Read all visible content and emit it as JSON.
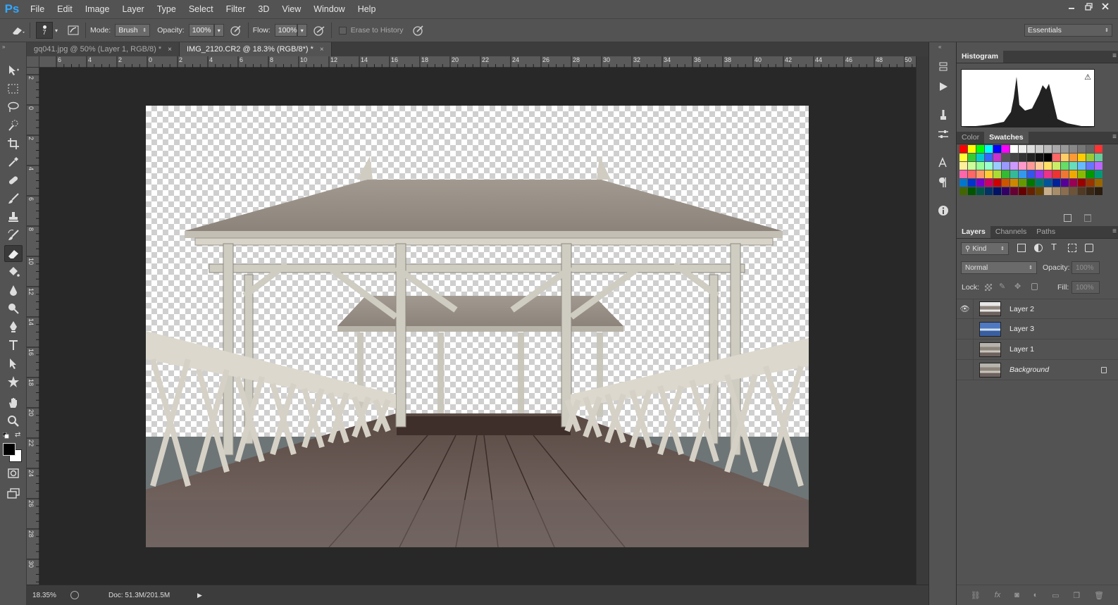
{
  "app": {
    "logo": "Ps"
  },
  "menus": [
    "File",
    "Edit",
    "Image",
    "Layer",
    "Type",
    "Select",
    "Filter",
    "3D",
    "View",
    "Window",
    "Help"
  ],
  "options": {
    "brush_size": "7",
    "mode_label": "Mode:",
    "mode_value": "Brush",
    "opacity_label": "Opacity:",
    "opacity_value": "100%",
    "flow_label": "Flow:",
    "flow_value": "100%",
    "erase_to_history": "Erase to History",
    "workspace": "Essentials"
  },
  "tabs": [
    {
      "label": "gq041.jpg @ 50% (Layer 1, RGB/8) *",
      "close": "×",
      "active": false
    },
    {
      "label": "IMG_2120.CR2 @ 18.3% (RGB/8*) *",
      "close": "×",
      "active": true
    }
  ],
  "rulers": {
    "h": [
      "6",
      "4",
      "2",
      "0",
      "2",
      "4",
      "6",
      "8",
      "10",
      "12",
      "14",
      "16",
      "18",
      "20",
      "22",
      "24",
      "26",
      "28",
      "30",
      "32",
      "34",
      "36",
      "38",
      "40",
      "42",
      "44",
      "46",
      "48",
      "50"
    ],
    "v": [
      "2",
      "0",
      "2",
      "4",
      "6",
      "8",
      "10",
      "12",
      "14",
      "16",
      "18",
      "20",
      "22",
      "24",
      "26",
      "28",
      "30"
    ]
  },
  "status": {
    "zoom": "18.35%",
    "doc": "Doc: 51.3M/201.5M"
  },
  "panels": {
    "histogram_tab": "Histogram",
    "color_tabs": [
      "Color",
      "Swatches"
    ],
    "layers_tabs": [
      "Layers",
      "Channels",
      "Paths"
    ],
    "kind_label": "Kind",
    "blend_mode": "Normal",
    "opacity_label": "Opacity:",
    "opacity_value": "100%",
    "lock_label": "Lock:",
    "fill_label": "Fill:",
    "fill_value": "100%"
  },
  "layers": [
    {
      "name": "Layer 2",
      "visible": true
    },
    {
      "name": "Layer 3",
      "visible": false
    },
    {
      "name": "Layer 1",
      "visible": false
    },
    {
      "name": "Background",
      "visible": false,
      "locked": true
    }
  ],
  "colors": {
    "accent": "#31a8ff",
    "panel": "#535353",
    "canvas_bg": "#282828"
  }
}
